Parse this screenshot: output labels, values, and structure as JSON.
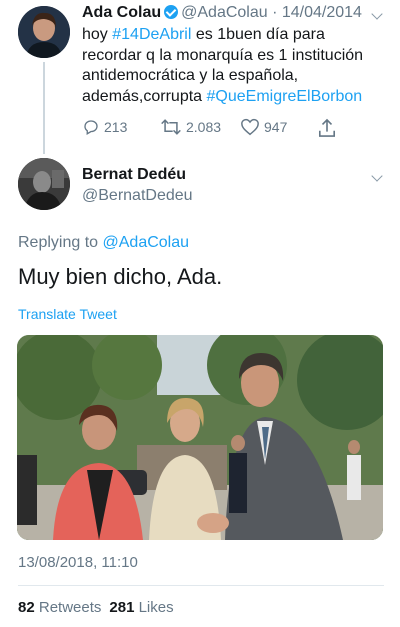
{
  "parent_tweet": {
    "name": "Ada Colau",
    "handle": "@AdaColau",
    "date": "14/04/2014",
    "text_lines": [
      [
        {
          "t": "hoy "
        },
        {
          "t": "#14DeAbril",
          "tag": true
        },
        {
          "t": " es 1buen día para"
        }
      ],
      [
        {
          "t": "recordar q la monarquía es 1 institución"
        }
      ],
      [
        {
          "t": "antidemocrática y la española,"
        }
      ],
      [
        {
          "t": "además,corrupta "
        },
        {
          "t": "#QueEmigreElBorbon",
          "tag": true
        }
      ]
    ],
    "replies": "213",
    "retweets": "2.083",
    "likes": "947"
  },
  "main_tweet": {
    "name": "Bernat Dedéu",
    "handle": "@BernatDedeu",
    "replying_prefix": "Replying to ",
    "replying_mention": "@AdaColau",
    "text": "Muy bien dicho, Ada.",
    "translate_label": "Translate Tweet",
    "timestamp": "13/08/2018, 11:10",
    "retweets_count": "82",
    "retweets_label": "Retweets",
    "likes_count": "281",
    "likes_label": "Likes"
  },
  "colors": {
    "accent": "#1da1f2",
    "secondary_text": "#657786",
    "primary_text": "#14171a"
  }
}
